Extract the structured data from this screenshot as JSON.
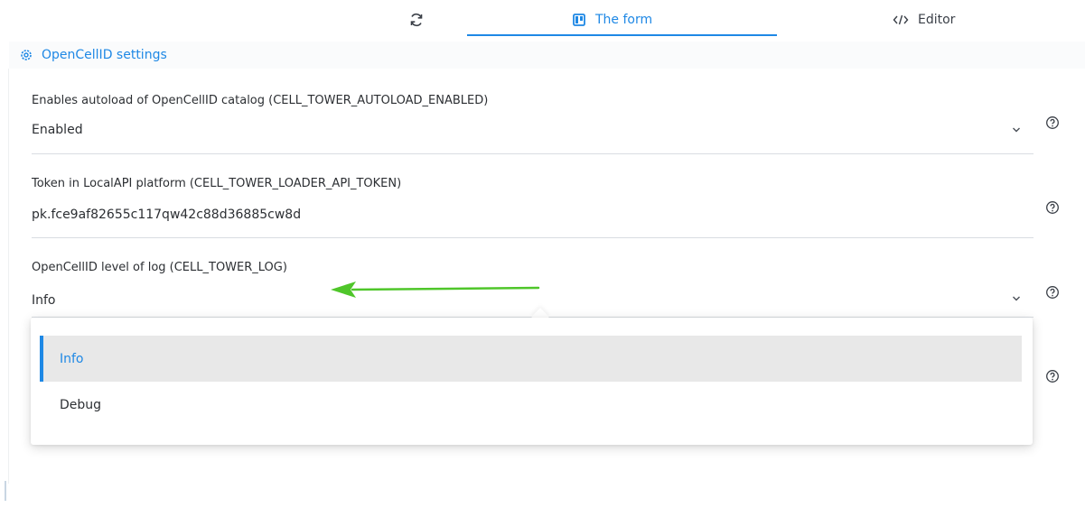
{
  "tabs": {
    "refresh_icon": "refresh-icon",
    "form_label": "The form",
    "editor_label": "Editor"
  },
  "panel": {
    "title": "OpenCellID settings",
    "icon": "gear-icon"
  },
  "fields": [
    {
      "label": "Enables autoload of OpenCellID catalog (CELL_TOWER_AUTOLOAD_ENABLED)",
      "value": "Enabled",
      "type": "select"
    },
    {
      "label": "Token in LocalAPI platform (CELL_TOWER_LOADER_API_TOKEN)",
      "value": "pk.fce9af82655c117qw42c88d36885cw8d",
      "type": "text"
    },
    {
      "label": "OpenCellID level of log (CELL_TOWER_LOG)",
      "value": "Info",
      "type": "select"
    }
  ],
  "dropdown": {
    "options": [
      "Info",
      "Debug"
    ],
    "selected": "Info"
  },
  "colors": {
    "accent": "#1e88e5",
    "arrow": "#4fc62a",
    "selected_bg": "#e8e8e8"
  }
}
